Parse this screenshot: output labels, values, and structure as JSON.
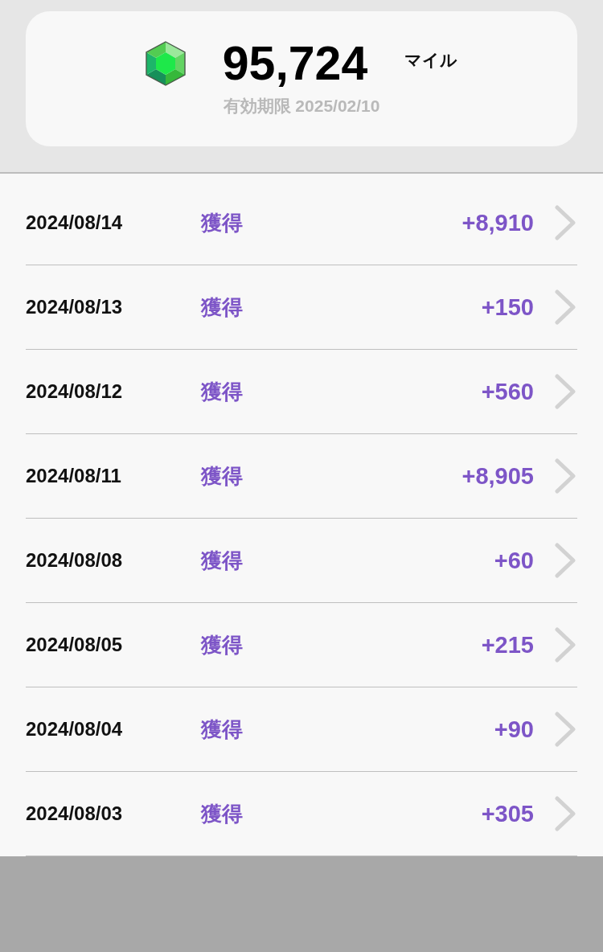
{
  "summary": {
    "balance": "95,724",
    "unit": "マイル",
    "expiry": "有効期限 2025/02/10"
  },
  "history": [
    {
      "date": "2024/08/14",
      "type": "獲得",
      "amount": "+8,910"
    },
    {
      "date": "2024/08/13",
      "type": "獲得",
      "amount": "+150"
    },
    {
      "date": "2024/08/12",
      "type": "獲得",
      "amount": "+560"
    },
    {
      "date": "2024/08/11",
      "type": "獲得",
      "amount": "+8,905"
    },
    {
      "date": "2024/08/08",
      "type": "獲得",
      "amount": "+60"
    },
    {
      "date": "2024/08/05",
      "type": "獲得",
      "amount": "+215"
    },
    {
      "date": "2024/08/04",
      "type": "獲得",
      "amount": "+90"
    },
    {
      "date": "2024/08/03",
      "type": "獲得",
      "amount": "+305"
    }
  ]
}
